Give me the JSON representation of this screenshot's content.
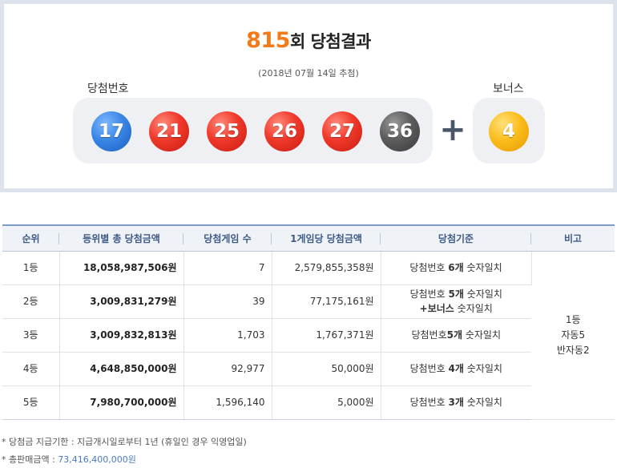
{
  "header": {
    "draw_number": "815",
    "title_suffix": "회 당첨결과",
    "date": "(2018년 07월 14일 추첨)",
    "winning_label": "당첨번호",
    "bonus_label": "보너스"
  },
  "balls": [
    {
      "number": "17",
      "color": "#3a86e6"
    },
    {
      "number": "21",
      "color": "#f0382a"
    },
    {
      "number": "25",
      "color": "#f0382a"
    },
    {
      "number": "26",
      "color": "#f0382a"
    },
    {
      "number": "27",
      "color": "#f0382a"
    },
    {
      "number": "36",
      "color": "#5c5c5c"
    }
  ],
  "plus_symbol": "+",
  "bonus_ball": {
    "number": "4",
    "color": "#fbbd1c"
  },
  "table": {
    "headers": [
      "순위",
      "등위별 총 당첨금액",
      "당첨게임 수",
      "1게임당 당첨금액",
      "당첨기준",
      "비고"
    ],
    "rows": [
      {
        "rank": "1등",
        "total": "18,058,987,506원",
        "games": "7",
        "per_game": "2,579,855,358원",
        "criteria_pre": "당첨번호 ",
        "criteria_bold": "6개",
        "criteria_post": " 숫자일치"
      },
      {
        "rank": "2등",
        "total": "3,009,831,279원",
        "games": "39",
        "per_game": "77,175,161원",
        "criteria_pre": "당첨번호 ",
        "criteria_bold": "5개",
        "criteria_post": " 숫자일치",
        "criteria_line2_bold": "+보너스",
        "criteria_line2_post": " 숫자일치"
      },
      {
        "rank": "3등",
        "total": "3,009,832,813원",
        "games": "1,703",
        "per_game": "1,767,371원",
        "criteria_pre": "당첨번호",
        "criteria_bold": "5개",
        "criteria_post": " 숫자일치"
      },
      {
        "rank": "4등",
        "total": "4,648,850,000원",
        "games": "92,977",
        "per_game": "50,000원",
        "criteria_pre": "당첨번호 ",
        "criteria_bold": "4개",
        "criteria_post": " 숫자일치"
      },
      {
        "rank": "5등",
        "total": "7,980,700,000원",
        "games": "1,596,140",
        "per_game": "5,000원",
        "criteria_pre": "당첨번호 ",
        "criteria_bold": "3개",
        "criteria_post": " 숫자일치"
      }
    ],
    "remark_lines": [
      "1등",
      "자동5",
      "반자동2"
    ]
  },
  "notes": {
    "deadline": "* 당첨금 지급기한 : 지급개시일로부터 1년 (휴일인 경우 익영업일)",
    "sales_label": "* 총판매금액 : ",
    "sales_amount": "73,416,400,000원"
  }
}
